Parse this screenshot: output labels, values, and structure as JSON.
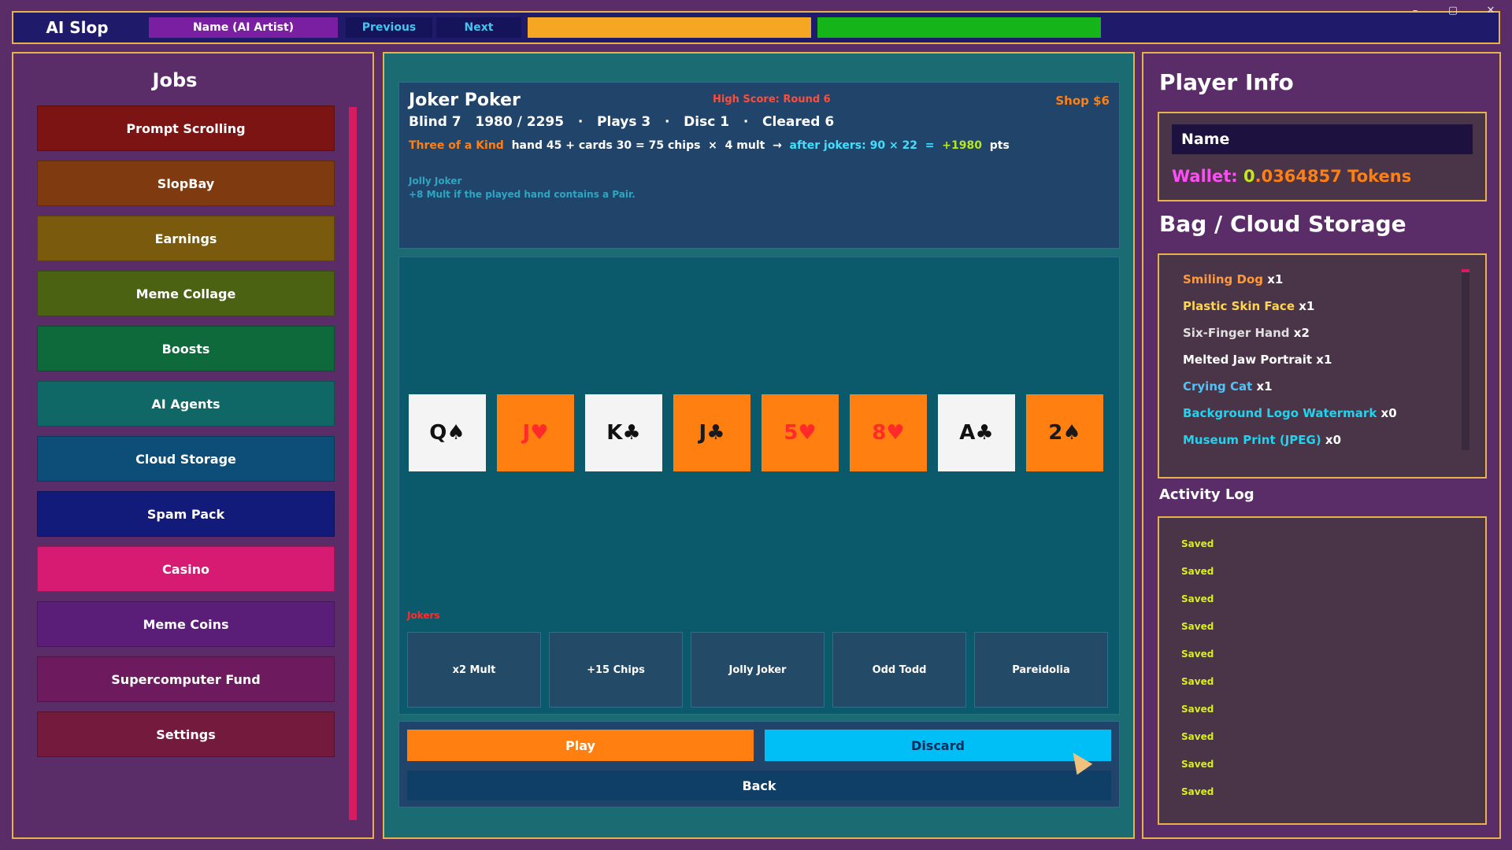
{
  "window_controls": {
    "min": "–",
    "max": "▢",
    "close": "✕"
  },
  "topbar": {
    "app_title": "AI Slop",
    "name_label": "Name (AI Artist)",
    "previous_label": "Previous",
    "next_label": "Next",
    "bar_colors": {
      "left": "#f5a623",
      "right": "#15b51a"
    }
  },
  "jobs": {
    "title": "Jobs",
    "items": [
      {
        "label": "Prompt Scrolling",
        "color": "#7d1414"
      },
      {
        "label": "SlopBay",
        "color": "#803a0f"
      },
      {
        "label": "Earnings",
        "color": "#7a5b0e"
      },
      {
        "label": "Meme Collage",
        "color": "#4a6212"
      },
      {
        "label": "Boosts",
        "color": "#0e6a3a"
      },
      {
        "label": "AI Agents",
        "color": "#0f6866"
      },
      {
        "label": "Cloud Storage",
        "color": "#0d4e78"
      },
      {
        "label": "Spam Pack",
        "color": "#131b7a"
      },
      {
        "label": "Casino",
        "color": "#d81b72"
      },
      {
        "label": "Meme Coins",
        "color": "#5a1d78"
      },
      {
        "label": "Supercomputer Fund",
        "color": "#6e1a5e"
      },
      {
        "label": "Settings",
        "color": "#741a3c"
      }
    ]
  },
  "game": {
    "title": "Joker Poker",
    "high_score": "High Score: Round 6",
    "shop": "Shop $6",
    "stats": "Blind 7   1980 / 2295   ·   Plays 3   ·   Disc 1   ·   Cleared 6",
    "calc": {
      "hand_name": "Three of a Kind",
      "hand_detail": "  hand 45 + cards 30 = 75 chips  ×  4 mult  →  ",
      "after_jokers": "after jokers: 90 × 22  =  ",
      "bonus": "+1980",
      "unit": "  pts"
    },
    "joker_desc": {
      "title": "Jolly Joker",
      "text": "+8 Mult if the played hand contains a Pair."
    },
    "cards": [
      {
        "rank": "Q",
        "suit": "♠",
        "face": "white",
        "red": false
      },
      {
        "rank": "J",
        "suit": "♥",
        "face": "orange",
        "red": true
      },
      {
        "rank": "K",
        "suit": "♣",
        "face": "white",
        "red": false
      },
      {
        "rank": "J",
        "suit": "♣",
        "face": "orange",
        "red": false
      },
      {
        "rank": "5",
        "suit": "♥",
        "face": "orange",
        "red": true
      },
      {
        "rank": "8",
        "suit": "♥",
        "face": "orange",
        "red": true
      },
      {
        "rank": "A",
        "suit": "♣",
        "face": "white",
        "red": false
      },
      {
        "rank": "2",
        "suit": "♠",
        "face": "orange",
        "red": false
      }
    ],
    "jokers_label": "Jokers",
    "jokers": [
      "x2 Mult",
      "+15 Chips",
      "Jolly Joker",
      "Odd Todd",
      "Pareidolia"
    ],
    "play_label": "Play",
    "discard_label": "Discard",
    "back_label": "Back"
  },
  "player": {
    "title": "Player Info",
    "name": "Name",
    "wallet_label": "Wallet: ",
    "wallet_zero": "0",
    "wallet_amount": ".0364857 Tokens"
  },
  "bag": {
    "title": "Bag / Cloud Storage",
    "items": [
      {
        "name": "Smiling Dog",
        "qty": "x1",
        "color": "#ff9a3c"
      },
      {
        "name": "Plastic Skin Face",
        "qty": "x1",
        "color": "#ffd54f"
      },
      {
        "name": "Six-Finger Hand",
        "qty": "x2",
        "color": "#e0e0e0"
      },
      {
        "name": "Melted Jaw Portrait",
        "qty": "x1",
        "color": "#ffffff"
      },
      {
        "name": "Crying Cat",
        "qty": "x1",
        "color": "#4fc3f7"
      },
      {
        "name": "Background Logo Watermark",
        "qty": "x0",
        "color": "#22d3ee"
      },
      {
        "name": "Museum Print (JPEG)",
        "qty": "x0",
        "color": "#22d3ee"
      }
    ]
  },
  "log": {
    "title": "Activity Log",
    "entries": [
      "Saved",
      "Saved",
      "Saved",
      "Saved",
      "Saved",
      "Saved",
      "Saved",
      "Saved",
      "Saved",
      "Saved"
    ]
  }
}
